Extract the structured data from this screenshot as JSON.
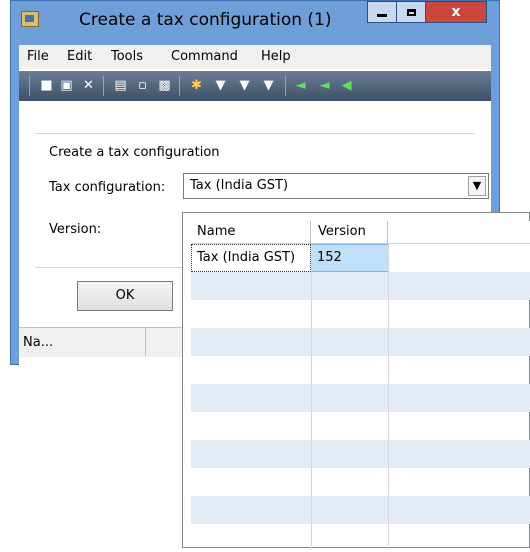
{
  "window": {
    "title": "Create a tax configuration (1)",
    "close_glyph": "x"
  },
  "menu": {
    "items": [
      "File",
      "Edit",
      "Tools",
      "Command",
      "Help"
    ]
  },
  "form": {
    "section_title": "Create a tax configuration",
    "tax_config_label": "Tax configuration:",
    "tax_config_value": "Tax (India GST)",
    "version_label": "Version:",
    "ok_label": "OK"
  },
  "status": {
    "text": "Na..."
  },
  "lookup": {
    "columns": [
      "Name",
      "Version"
    ],
    "rows": [
      {
        "name": "Tax (India GST)",
        "version": "152"
      }
    ]
  },
  "colors": {
    "title_bar": "#6f9fd8",
    "close_button": "#c9463d",
    "row_alt": "#e3ebf7",
    "selected_cell": "#bfe0f8"
  }
}
